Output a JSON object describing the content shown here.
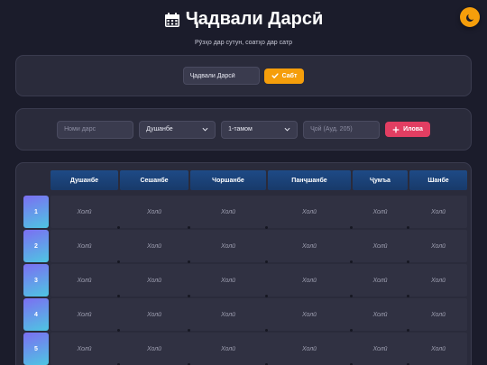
{
  "theme_toggle": {
    "icon": "moon-icon"
  },
  "header": {
    "title": "Ҷадвали Дарсӣ",
    "subtitle": "Рӯзҳо дар сутун, соатҳо дар сатр"
  },
  "save_section": {
    "name_value": "Ҷадвали Дарсӣ",
    "save_label": "Сабт"
  },
  "add_section": {
    "lesson_placeholder": "Номи дарс",
    "day_selected": "Душанбе",
    "period_selected": "1-тамом",
    "room_placeholder": "Ҷой (Ауд. 205)",
    "add_label": "Илова"
  },
  "table": {
    "days": [
      "Душанбе",
      "Сешанбе",
      "Чоршанбе",
      "Панҷшанбе",
      "Ҷумъа",
      "Шанбе"
    ],
    "periods": [
      "1",
      "2",
      "3",
      "4",
      "5"
    ],
    "empty_label": "Холӣ"
  },
  "colors": {
    "accent_orange": "#f59e0b",
    "add_button": "#e23e62",
    "day_header": "#1e4a86"
  }
}
